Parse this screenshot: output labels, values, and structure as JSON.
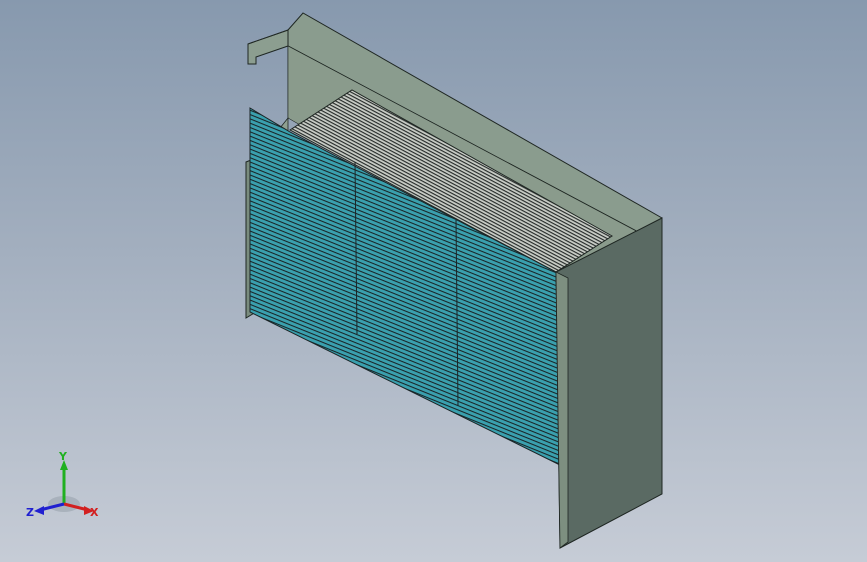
{
  "viewport": {
    "background_top": "#8799ae",
    "background_bottom": "#c6ccd6"
  },
  "model": {
    "frame_color": "#7a8f80",
    "panel_dark": "#5a6a62",
    "fin_color": "#3fa0b0",
    "fin_dark": "#1c2a2c",
    "mesh_color": "#2c3333"
  },
  "triad": {
    "x_label": "X",
    "y_label": "Y",
    "z_label": "Z",
    "x_color": "#d22020",
    "y_color": "#20b020",
    "z_color": "#2020d0"
  }
}
